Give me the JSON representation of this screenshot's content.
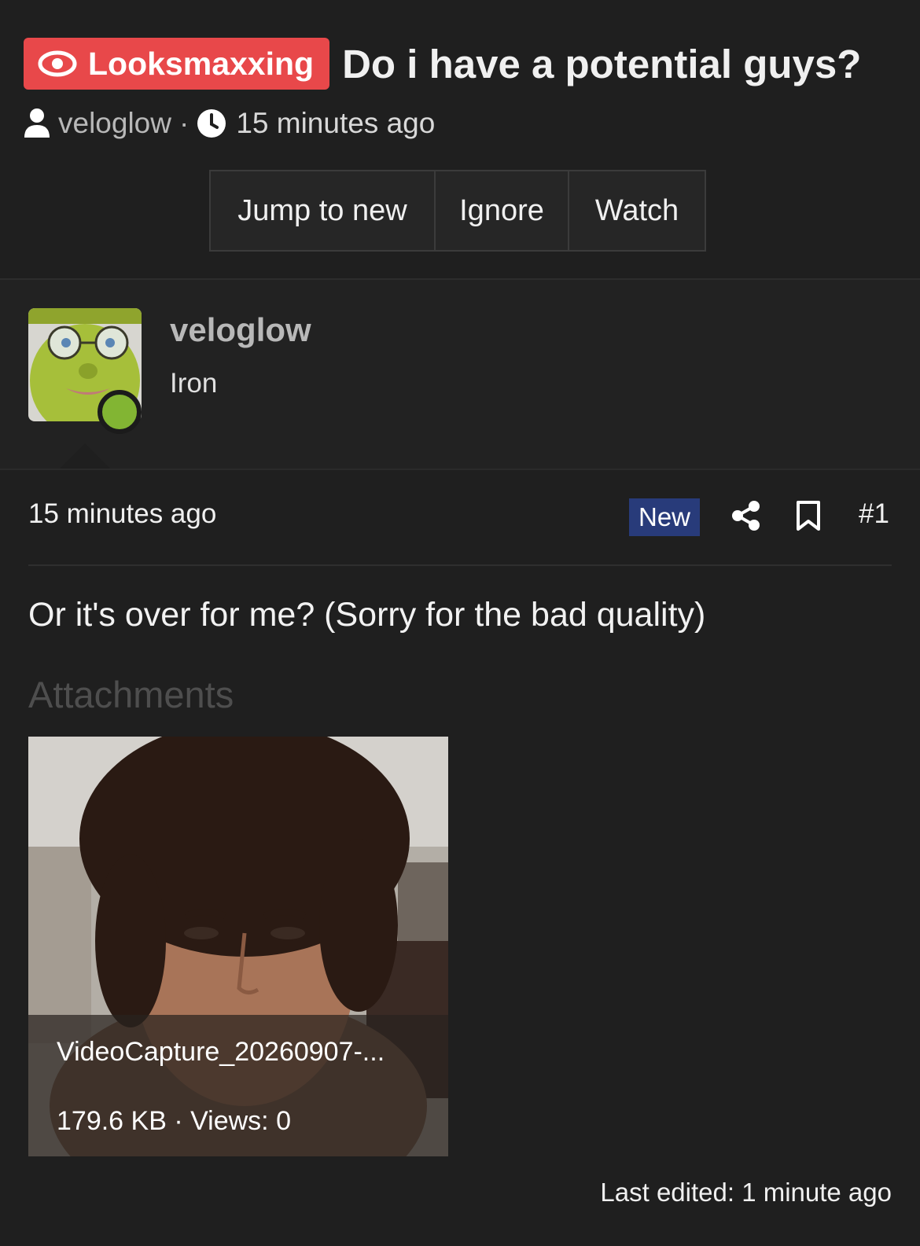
{
  "thread": {
    "prefix": "Looksmaxxing",
    "title": "Do i have a potential guys?",
    "author": "veloglow",
    "separator": "·",
    "time": "15 minutes ago",
    "accent_color": "#e8484a"
  },
  "actions": {
    "jump_to_new": "Jump to new",
    "ignore": "Ignore",
    "watch": "Watch"
  },
  "user": {
    "name": "veloglow",
    "title": "Iron",
    "online": true,
    "online_color": "#82b533"
  },
  "post": {
    "time": "15 minutes ago",
    "new_label": "New",
    "new_color": "#283b7a",
    "number": "#1",
    "body": "Or it's over for me? (Sorry for the bad quality)",
    "attachments_label": "Attachments",
    "attachment": {
      "filename": "VideoCapture_20260907-...",
      "meta": "179.6 KB · Views: 0"
    },
    "last_edited": "Last edited: 1 minute ago"
  },
  "icons": {
    "prefix": "eye-icon",
    "author": "user-icon",
    "time": "clock-icon",
    "share": "share-icon",
    "bookmark": "bookmark-icon"
  }
}
